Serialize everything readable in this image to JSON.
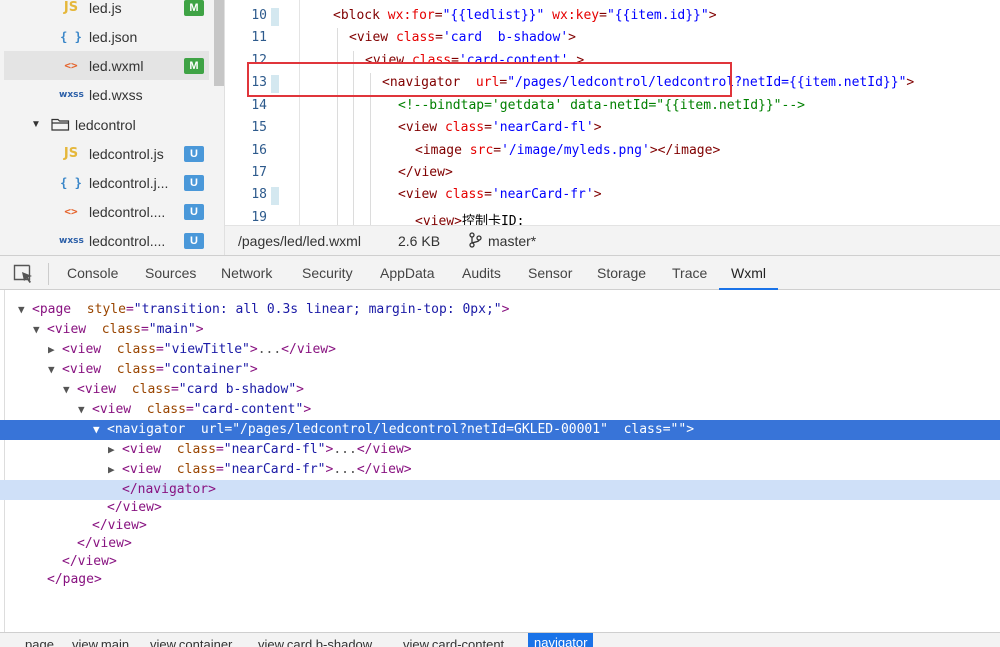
{
  "file_tree": {
    "items": [
      {
        "name": "led.js",
        "icon": "js-file-icon",
        "icon_text": "JS",
        "badge": "M"
      },
      {
        "name": "led.json",
        "icon": "json-file-icon",
        "icon_text": "{ }",
        "badge": ""
      },
      {
        "name": "led.wxml",
        "icon": "wxml-file-icon",
        "icon_text": "<>",
        "badge": "M"
      },
      {
        "name": "led.wxss",
        "icon": "wxss-file-icon",
        "icon_text": "wxss",
        "badge": ""
      },
      {
        "name": "ledcontrol",
        "icon": "folder-open-icon",
        "icon_text": "",
        "badge": ""
      },
      {
        "name": "ledcontrol.js",
        "icon": "js-file-icon",
        "icon_text": "JS",
        "badge": "U"
      },
      {
        "name": "ledcontrol.j...",
        "icon": "json-file-icon",
        "icon_text": "{ }",
        "badge": "U"
      },
      {
        "name": "ledcontrol....",
        "icon": "wxml-file-icon",
        "icon_text": "<>",
        "badge": "U"
      },
      {
        "name": "ledcontrol....",
        "icon": "wxss-file-icon",
        "icon_text": "wxss",
        "badge": "U"
      }
    ]
  },
  "editor": {
    "lines": [
      {
        "num": "10",
        "tokens": [
          {
            "t": "tag",
            "s": "<block "
          },
          {
            "t": "attr",
            "s": "wx:for"
          },
          {
            "t": "tag",
            "s": "="
          },
          {
            "t": "val",
            "s": "\"{{ledlist}}\""
          },
          {
            "t": "tag",
            "s": " "
          },
          {
            "t": "attr",
            "s": "wx:key"
          },
          {
            "t": "tag",
            "s": "="
          },
          {
            "t": "val",
            "s": "\"{{item.id}}\""
          },
          {
            "t": "tag",
            "s": ">"
          }
        ]
      },
      {
        "num": "11",
        "tokens": [
          {
            "t": "tag",
            "s": "<view "
          },
          {
            "t": "attr",
            "s": "class"
          },
          {
            "t": "tag",
            "s": "="
          },
          {
            "t": "val",
            "s": "'card  b-shadow'"
          },
          {
            "t": "tag",
            "s": ">"
          }
        ]
      },
      {
        "num": "12",
        "tokens": [
          {
            "t": "tag",
            "s": "<view "
          },
          {
            "t": "attr",
            "s": "class"
          },
          {
            "t": "tag",
            "s": "="
          },
          {
            "t": "val",
            "s": "'card-content'"
          },
          {
            "t": "tag",
            "s": " >"
          }
        ]
      },
      {
        "num": "13",
        "tokens": [
          {
            "t": "tag",
            "s": "<navigator  "
          },
          {
            "t": "attr",
            "s": "url"
          },
          {
            "t": "tag",
            "s": "="
          },
          {
            "t": "val",
            "s": "\"/pages/ledcontrol/ledcontrol?netId={{item.netId}}\""
          },
          {
            "t": "tag",
            "s": ">"
          }
        ]
      },
      {
        "num": "14",
        "tokens": [
          {
            "t": "comment",
            "s": "<!--bindtap='getdata' data-netId=\"{{item.netId}}\"-->"
          }
        ]
      },
      {
        "num": "15",
        "tokens": [
          {
            "t": "tag",
            "s": "<view "
          },
          {
            "t": "attr",
            "s": "class"
          },
          {
            "t": "tag",
            "s": "="
          },
          {
            "t": "val",
            "s": "'nearCard-fl'"
          },
          {
            "t": "tag",
            "s": ">"
          }
        ]
      },
      {
        "num": "16",
        "tokens": [
          {
            "t": "tag",
            "s": "<image "
          },
          {
            "t": "attr",
            "s": "src"
          },
          {
            "t": "tag",
            "s": "="
          },
          {
            "t": "val",
            "s": "'/image/myleds.png'"
          },
          {
            "t": "tag",
            "s": "></image>"
          }
        ]
      },
      {
        "num": "17",
        "tokens": [
          {
            "t": "tag",
            "s": "</view>"
          }
        ]
      },
      {
        "num": "18",
        "tokens": [
          {
            "t": "tag",
            "s": "<view "
          },
          {
            "t": "attr",
            "s": "class"
          },
          {
            "t": "tag",
            "s": "="
          },
          {
            "t": "val",
            "s": "'nearCard-fr'"
          },
          {
            "t": "tag",
            "s": ">"
          }
        ]
      },
      {
        "num": "19",
        "tokens": [
          {
            "t": "tag",
            "s": "<view>"
          },
          {
            "t": "text",
            "s": "控制卡ID:"
          }
        ]
      }
    ]
  },
  "status_bar": {
    "path": "/pages/led/led.wxml",
    "size": "2.6 KB",
    "branch": "master*"
  },
  "devtools": {
    "tabs": [
      "Console",
      "Sources",
      "Network",
      "Security",
      "AppData",
      "Audits",
      "Sensor",
      "Storage",
      "Trace",
      "Wxml"
    ],
    "active_tab": "Wxml",
    "dom_rows": [
      {
        "caret": "▼",
        "parts": [
          {
            "t": "tag",
            "s": "<page "
          },
          {
            "t": "attr",
            "s": " style"
          },
          {
            "t": "tag",
            "s": "="
          },
          {
            "t": "val",
            "s": "\"transition: all 0.3s linear; margin-top: 0px;\""
          },
          {
            "t": "tag",
            "s": ">"
          }
        ]
      },
      {
        "caret": "▼",
        "parts": [
          {
            "t": "tag",
            "s": "<view "
          },
          {
            "t": "attr",
            "s": " class"
          },
          {
            "t": "tag",
            "s": "="
          },
          {
            "t": "val",
            "s": "\"main\""
          },
          {
            "t": "tag",
            "s": ">"
          }
        ]
      },
      {
        "caret": "▶",
        "parts": [
          {
            "t": "tag",
            "s": "<view "
          },
          {
            "t": "attr",
            "s": " class"
          },
          {
            "t": "tag",
            "s": "="
          },
          {
            "t": "val",
            "s": "\"viewTitle\""
          },
          {
            "t": "tag",
            "s": ">"
          },
          {
            "t": "dots",
            "s": "..."
          },
          {
            "t": "tag",
            "s": "</view>"
          }
        ]
      },
      {
        "caret": "▼",
        "parts": [
          {
            "t": "tag",
            "s": "<view "
          },
          {
            "t": "attr",
            "s": " class"
          },
          {
            "t": "tag",
            "s": "="
          },
          {
            "t": "val",
            "s": "\"container\""
          },
          {
            "t": "tag",
            "s": ">"
          }
        ]
      },
      {
        "caret": "▼",
        "parts": [
          {
            "t": "tag",
            "s": "<view "
          },
          {
            "t": "attr",
            "s": " class"
          },
          {
            "t": "tag",
            "s": "="
          },
          {
            "t": "val",
            "s": "\"card b-shadow\""
          },
          {
            "t": "tag",
            "s": ">"
          }
        ]
      },
      {
        "caret": "▼",
        "parts": [
          {
            "t": "tag",
            "s": "<view "
          },
          {
            "t": "attr",
            "s": " class"
          },
          {
            "t": "tag",
            "s": "="
          },
          {
            "t": "val",
            "s": "\"card-content\""
          },
          {
            "t": "tag",
            "s": ">"
          }
        ]
      },
      {
        "caret": "▼",
        "parts": [
          {
            "t": "tag",
            "s": "<navigator "
          },
          {
            "t": "attr",
            "s": " url"
          },
          {
            "t": "tag",
            "s": "="
          },
          {
            "t": "val",
            "s": "\"/pages/ledcontrol/ledcontrol?netId=GKLED-00001\""
          },
          {
            "t": "tag",
            "s": " "
          },
          {
            "t": "attr",
            "s": " class"
          },
          {
            "t": "tag",
            "s": "="
          },
          {
            "t": "val",
            "s": "\"\""
          },
          {
            "t": "tag",
            "s": ">"
          }
        ]
      },
      {
        "caret": "▶",
        "parts": [
          {
            "t": "tag",
            "s": "<view "
          },
          {
            "t": "attr",
            "s": " class"
          },
          {
            "t": "tag",
            "s": "="
          },
          {
            "t": "val",
            "s": "\"nearCard-fl\""
          },
          {
            "t": "tag",
            "s": ">"
          },
          {
            "t": "dots",
            "s": "..."
          },
          {
            "t": "tag",
            "s": "</view>"
          }
        ]
      },
      {
        "caret": "▶",
        "parts": [
          {
            "t": "tag",
            "s": "<view "
          },
          {
            "t": "attr",
            "s": " class"
          },
          {
            "t": "tag",
            "s": "="
          },
          {
            "t": "val",
            "s": "\"nearCard-fr\""
          },
          {
            "t": "tag",
            "s": ">"
          },
          {
            "t": "dots",
            "s": "..."
          },
          {
            "t": "tag",
            "s": "</view>"
          }
        ]
      },
      {
        "caret": "",
        "parts": [
          {
            "t": "tag",
            "s": "</navigator>"
          }
        ]
      },
      {
        "caret": "",
        "parts": [
          {
            "t": "tag",
            "s": "</view>"
          }
        ]
      },
      {
        "caret": "",
        "parts": [
          {
            "t": "tag",
            "s": "</view>"
          }
        ]
      },
      {
        "caret": "",
        "parts": [
          {
            "t": "tag",
            "s": "</view>"
          }
        ]
      },
      {
        "caret": "",
        "parts": [
          {
            "t": "tag",
            "s": "</view>"
          }
        ]
      },
      {
        "caret": "",
        "parts": [
          {
            "t": "tag",
            "s": "</page>"
          }
        ]
      }
    ],
    "breadcrumbs": [
      "page",
      "view.main",
      "view.container",
      "view.card.b-shadow",
      "view.card-content",
      "navigator"
    ]
  },
  "colors": {
    "accent": "#1a73e8",
    "selection": "#3874d8",
    "highlight_box": "#e0353b",
    "badge_modified": "#3fa345",
    "badge_untracked": "#4a98d9"
  }
}
